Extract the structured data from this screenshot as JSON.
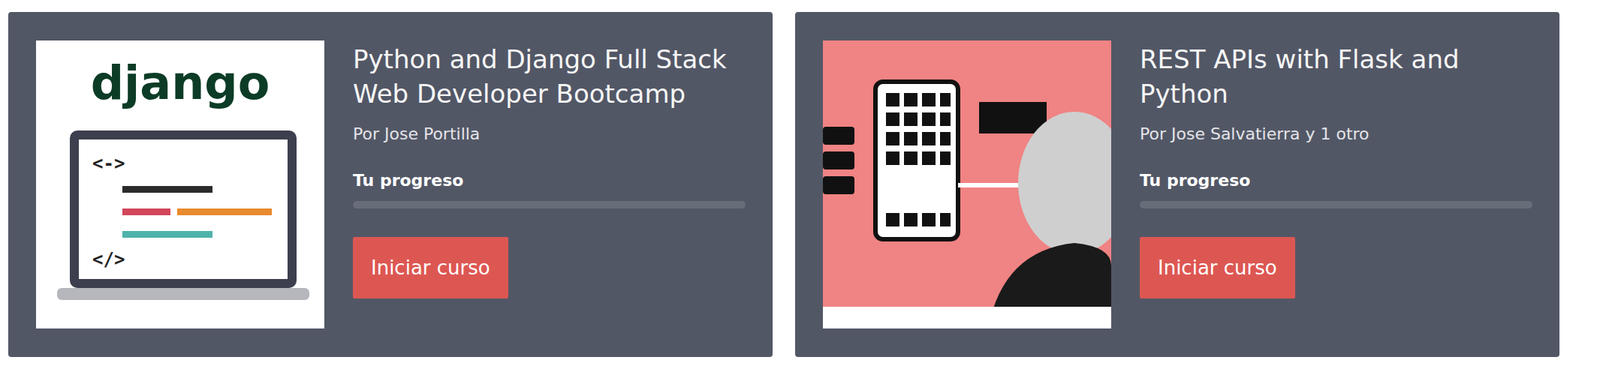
{
  "courses": [
    {
      "title": "Python and Django Full Stack Web Developer Bootcamp",
      "author": "Por Jose Portilla",
      "progress_label": "Tu progreso",
      "level": 0,
      "button": "Iniciar curso",
      "thumbnail": {
        "kind": "django",
        "logo": "django",
        "marks": [
          "<->",
          "</>"
        ]
      }
    },
    {
      "title": "REST APIs with Flask and Python",
      "author": "Por Jose Salvatierra y 1 otro",
      "progress_label": "Tu progreso",
      "level": 0,
      "button": "Iniciar curso",
      "thumbnail": {
        "kind": "photo",
        "logo": "",
        "marks": []
      }
    }
  ]
}
